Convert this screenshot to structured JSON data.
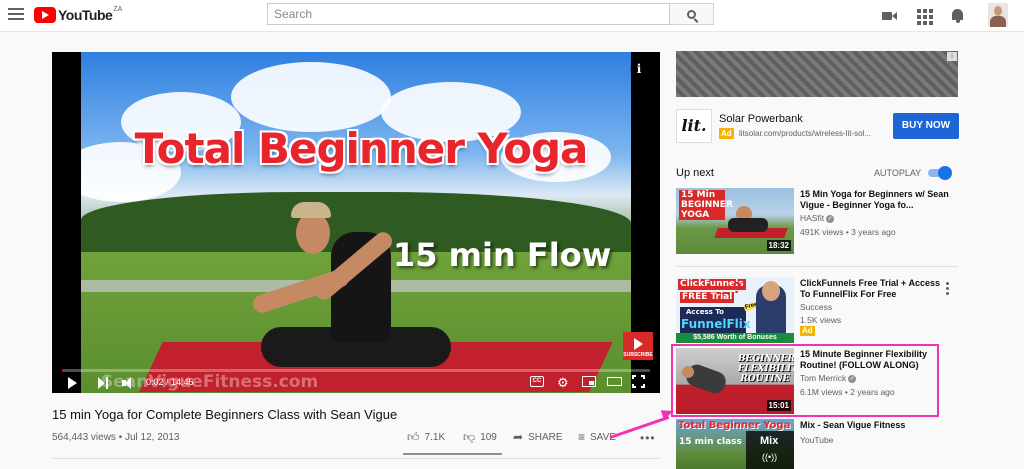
{
  "masthead": {
    "logo_text": "YouTube",
    "country": "ZA",
    "search_placeholder": "Search"
  },
  "player": {
    "overlay_title": "Total Beginner Yoga",
    "overlay_subtitle": "15 min Flow",
    "watermark": "SeanVigueFitness.com",
    "time_display": "0:02 / 14:45",
    "progress_fraction": 0.002,
    "subscribe_badge": "SUBSCRIBE",
    "cc_label": "CC"
  },
  "video": {
    "title": "15 min Yoga for Complete Beginners Class with Sean Vigue",
    "meta": "564,443 views • Jul 12, 2013",
    "likes": "7.1K",
    "dislikes": "109",
    "share_label": "SHARE",
    "save_label": "SAVE",
    "more_label": "•••"
  },
  "ad": {
    "logo_text": "lit.",
    "title": "Solar Powerbank",
    "badge": "Ad",
    "url": "litsolar.com/products/wireless-lit-sol...",
    "cta": "BUY NOW",
    "corner_label": "i"
  },
  "up_next": {
    "heading": "Up next",
    "autoplay_label": "AUTOPLAY",
    "autoplay_on": true
  },
  "recommendations": [
    {
      "thumb_text": "15 Min BEGINNER YOGA",
      "duration": "18:32",
      "title": "15 Min Yoga for Beginners w/ Sean Vigue - Beginner Yoga fo...",
      "channel": "HASfit",
      "verified": true,
      "stats": "491K views • 3 years ago"
    },
    {
      "thumb_text_1": "ClickFunnels",
      "thumb_text_2": "FREE Trial",
      "thumb_text_3": "Access To",
      "thumb_text_4": "FunnelFlix",
      "thumb_text_5": "$5,586 Worth of Bonuses",
      "thumb_badge": "Free!",
      "title": "ClickFunnels Free Trial + Access To FunnelFlix For Free",
      "channel": "Success",
      "stats": "1.5K views",
      "ad_badge": "Ad"
    },
    {
      "thumb_text": "BEGINNER FLEXIBILITY ROUTINE",
      "duration": "15:01",
      "title": "15 Minute Beginner Flexibility Routine! (FOLLOW ALONG)",
      "channel": "Tom Merrick",
      "verified": true,
      "stats": "6.1M views • 2 years ago"
    },
    {
      "thumb_text_1": "Total Beginner Yoga",
      "thumb_text_2": "15 min class",
      "mix_label": "Mix",
      "title": "Mix - Sean Vigue Fitness",
      "channel": "YouTube"
    }
  ],
  "colors": {
    "brand_red": "#ff0000",
    "annotation_pink": "#f032b4",
    "cta_blue": "#1e65d6",
    "ad_yellow": "#f4b400"
  }
}
